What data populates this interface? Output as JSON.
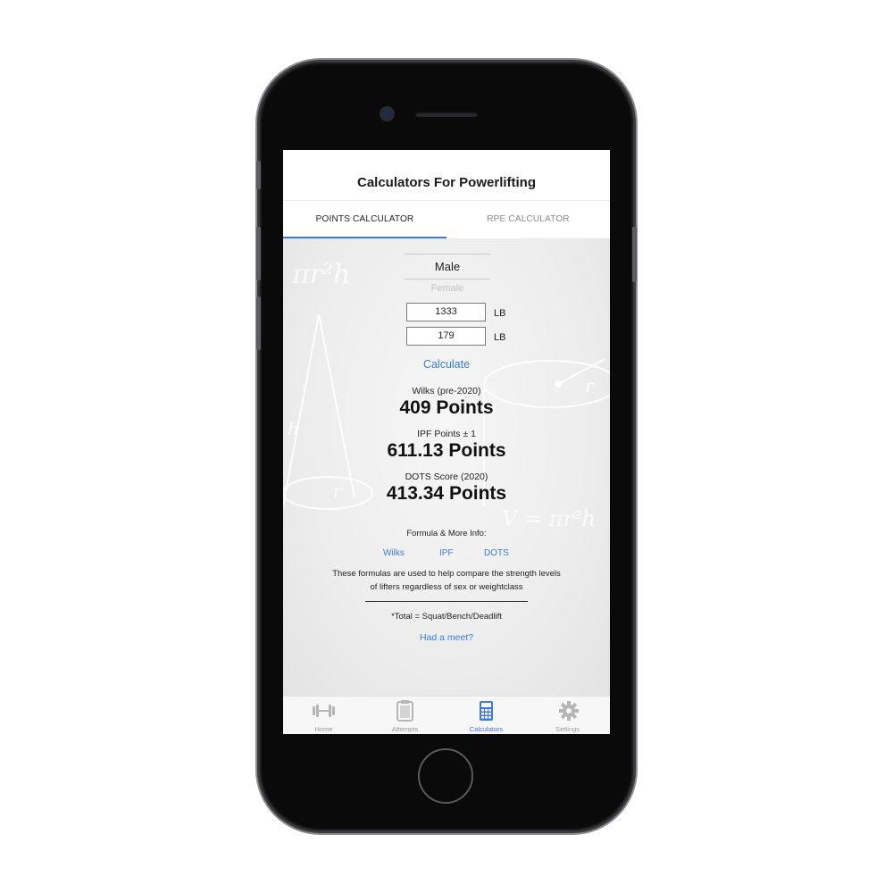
{
  "header": {
    "title": "Calculators For Powerlifting"
  },
  "tabs": [
    {
      "label": "POINTS CALCULATOR",
      "active": true
    },
    {
      "label": "RPE CALCULATOR",
      "active": false
    }
  ],
  "sex_picker": {
    "selected": "Male",
    "other": "Female"
  },
  "inputs": {
    "total": {
      "value": "1333",
      "unit": "LB"
    },
    "bodyweight": {
      "value": "179",
      "unit": "LB"
    }
  },
  "calculate_label": "Calculate",
  "results": [
    {
      "label": "Wilks (pre-2020)",
      "value": "409 Points"
    },
    {
      "label": "IPF Points ± 1",
      "value": "611.13 Points"
    },
    {
      "label": "DOTS Score (2020)",
      "value": "413.34 Points"
    }
  ],
  "formula": {
    "heading": "Formula & More Info:",
    "links": [
      "Wilks",
      "IPF",
      "DOTS"
    ],
    "description_line1": "These formulas are used to help compare the strength levels",
    "description_line2": "of lifters regardless of sex or weightclass"
  },
  "total_note": "*Total = Squat/Bench/Deadlift",
  "meet_link": "Had a meet?",
  "background_formulas": {
    "formula_a": "πr²h",
    "formula_b": "V = πr²h",
    "radius_label": "r",
    "height_label": "h",
    "cone_radius": "r"
  },
  "tabbar": [
    {
      "label": "Home",
      "icon": "barbell-icon",
      "active": false
    },
    {
      "label": "Attempts",
      "icon": "clipboard-icon",
      "active": false
    },
    {
      "label": "Calculators",
      "icon": "calculator-icon",
      "active": true
    },
    {
      "label": "Settings",
      "icon": "gear-icon",
      "active": false
    }
  ],
  "colors": {
    "accent": "#3b7be0",
    "inactive": "#9b9b9b"
  }
}
